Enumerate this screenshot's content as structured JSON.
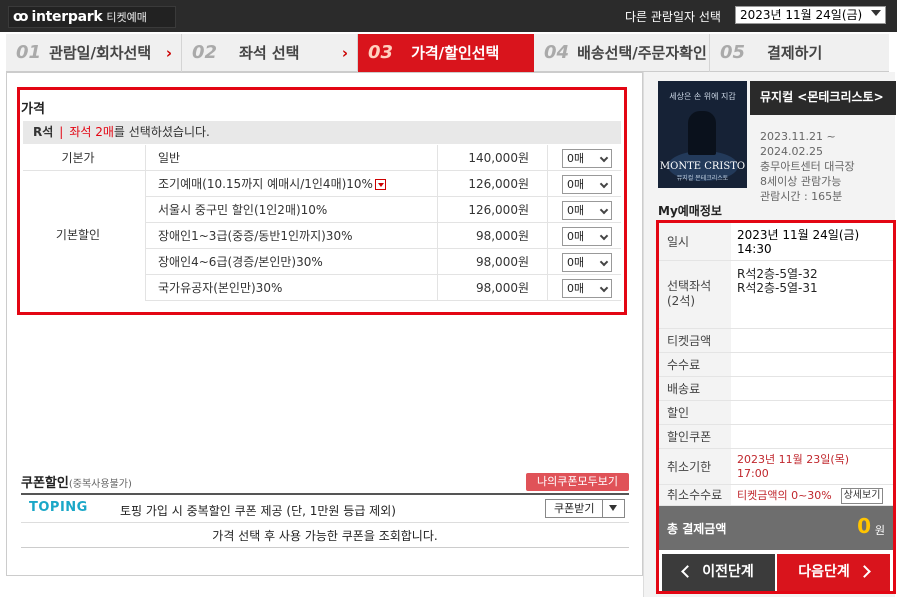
{
  "header": {
    "logo_brand": "interpark",
    "logo_service": "티켓예매",
    "other_date_label": "다른 관람일자 선택",
    "date_select_value": "2023년 11월 24일(금)"
  },
  "steps": [
    {
      "num": "01",
      "label": "관람일/회차선택"
    },
    {
      "num": "02",
      "label": "좌석 선택"
    },
    {
      "num": "03",
      "label": "가격/할인선택"
    },
    {
      "num": "04",
      "label": "배송선택/주문자확인"
    },
    {
      "num": "05",
      "label": "결제하기"
    }
  ],
  "price": {
    "title": "가격",
    "grade": "R석",
    "grade_sep": "|",
    "selected_highlight": "좌석 2매",
    "selected_suffix": "를 선택하셨습니다.",
    "base_category": "기본가",
    "discount_category": "기본할인",
    "rows": [
      {
        "name": "일반",
        "amount": "140,000원",
        "qty": "0매"
      },
      {
        "name": "조기예매(10.15까지 예매시/1인4매)10%",
        "amount": "126,000원",
        "qty": "0매"
      },
      {
        "name": "서울시 중구민 할인(1인2매)10%",
        "amount": "126,000원",
        "qty": "0매"
      },
      {
        "name": "장애인1~3급(중증/동반1인까지)30%",
        "amount": "98,000원",
        "qty": "0매"
      },
      {
        "name": "장애인4~6급(경증/본인만)30%",
        "amount": "98,000원",
        "qty": "0매"
      },
      {
        "name": "국가유공자(본인만)30%",
        "amount": "98,000원",
        "qty": "0매"
      }
    ]
  },
  "coupon": {
    "title": "쿠폰할인",
    "subtitle": "(중복사용불가)",
    "my_coupon_button": "나의쿠폰모두보기",
    "toping_logo": "TOPING",
    "description": "토핑 가입 시 중복할인 쿠폰 제공 (단, 1만원 등급 제외)",
    "get_button": "쿠폰받기",
    "info": "가격 선택 후 사용 가능한 쿠폰을 조회합니다."
  },
  "show": {
    "title": "뮤지컬 <몬테크리스토>",
    "period_line1": "2023.11.21 ~",
    "period_line2": "2024.02.25",
    "venue": "충무아트센터 대극장",
    "age": "8세이상 관람가능",
    "runtime": "관람시간 : 165분",
    "poster_top": "세상은 손 위에 지갑",
    "poster_title": "MONTE CRISTO",
    "poster_sub": "뮤지컬 몬테크리스토"
  },
  "summary": {
    "title": "My예매정보",
    "datetime_label": "일시",
    "datetime_line1": "2023년 11월 24일(금)",
    "datetime_line2": "14:30",
    "seats_label": "선택좌석",
    "seats_count": "(2석)",
    "seat1": "R석2층-5열-32",
    "seat2": "R석2층-5열-31",
    "ticket_amount_label": "티켓금액",
    "fee_label": "수수료",
    "delivery_label": "배송료",
    "discount_label": "할인",
    "discount_coupon_label": "할인쿠폰",
    "cancel_deadline_label": "취소기한",
    "cancel_deadline_line1": "2023년 11월 23일(목)",
    "cancel_deadline_line2": "17:00",
    "cancel_fee_label": "취소수수료",
    "cancel_fee_value": "티켓금액의 0~30%",
    "detail_button": "상세보기",
    "total_label": "총 결제금액",
    "total_amount": "0",
    "total_unit": "원",
    "prev_button": "이전단계",
    "next_button": "다음단계"
  }
}
